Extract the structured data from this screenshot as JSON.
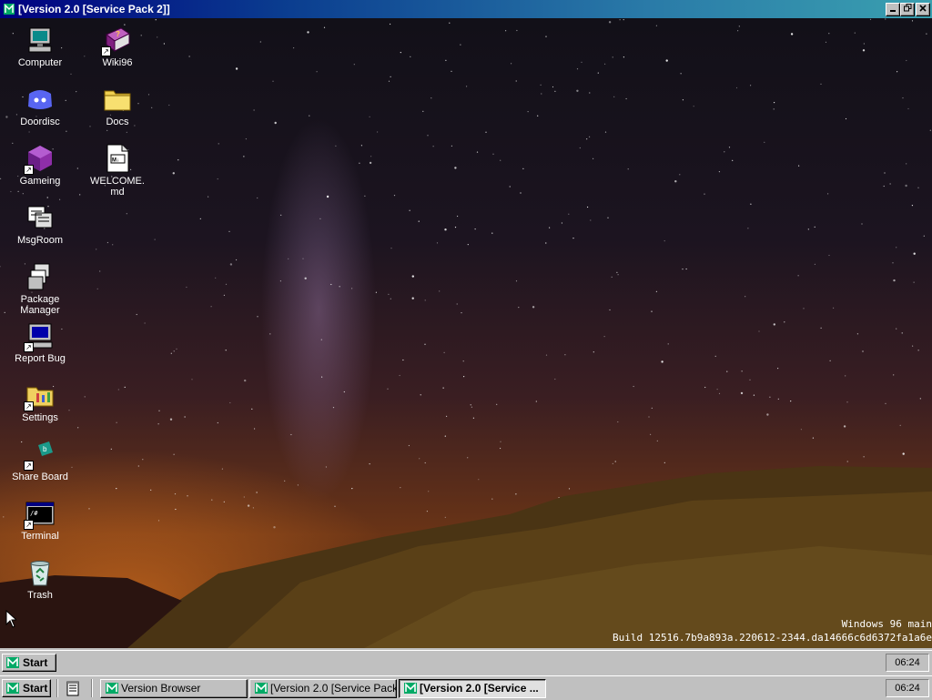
{
  "window": {
    "title": "[Version 2.0 [Service Pack 2]]",
    "minimize_icon": "minimize-icon",
    "maximize_icon": "restore-icon",
    "close_icon": "close-icon"
  },
  "desktop": {
    "icons": [
      {
        "label": "Computer",
        "icon": "computer-icon"
      },
      {
        "label": "Doordisc",
        "icon": "discord-icon"
      },
      {
        "label": "Gameing",
        "icon": "cube-icon"
      },
      {
        "label": "MsgRoom",
        "icon": "chat-icon"
      },
      {
        "label": "Package Manager",
        "icon": "package-icon"
      },
      {
        "label": "Report Bug",
        "icon": "bug-report-icon"
      },
      {
        "label": "Settings",
        "icon": "settings-folder-icon"
      },
      {
        "label": "Share Board",
        "icon": "share-icon"
      },
      {
        "label": "Terminal",
        "icon": "terminal-icon"
      },
      {
        "label": "Trash",
        "icon": "recycle-bin-icon"
      },
      {
        "label": "Wiki96",
        "icon": "book-icon"
      },
      {
        "label": "Docs",
        "icon": "folder-icon"
      },
      {
        "label": "WELCOME.md",
        "icon": "markdown-file-icon"
      }
    ],
    "build_line1": "Windows 96 main",
    "build_line2": "Build 12516.7b9a893a.220612-2344.da14666c6d6372fa1a6e"
  },
  "inner_taskbar": {
    "start_label": "Start",
    "clock": "06:24"
  },
  "taskbar": {
    "start_label": "Start",
    "clock": "06:24",
    "tasks": [
      {
        "label": "Version Browser",
        "active": false
      },
      {
        "label": "[Version 2.0 [Service Pack...",
        "active": false
      },
      {
        "label": "[Version 2.0 [Service ...",
        "active": true
      }
    ]
  },
  "colors": {
    "title_start": "#000080",
    "title_end": "#3aa0b0",
    "chrome": "#c0c0c0"
  }
}
